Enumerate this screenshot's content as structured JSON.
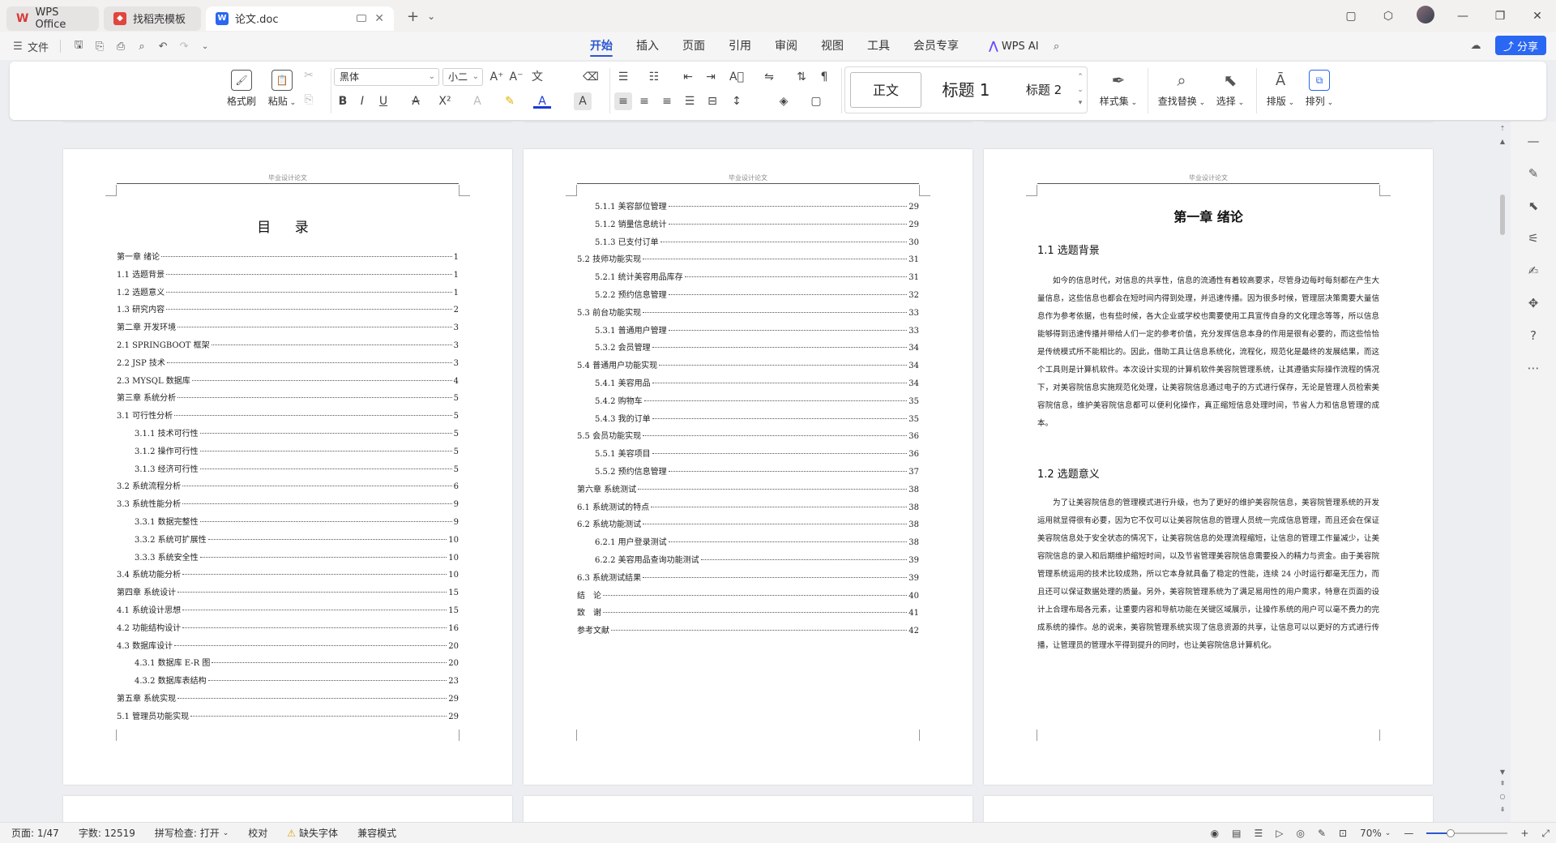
{
  "titlebar": {
    "tabs": [
      {
        "label": "WPS Office",
        "icon": "wps-logo-icon",
        "color": "#d63a3a"
      },
      {
        "label": "找稻壳模板",
        "icon": "docer-icon",
        "color": "#e0463d"
      },
      {
        "label": "论文.doc",
        "icon": "word-doc-icon",
        "color": "#2a67f2"
      }
    ],
    "new_tab": "+",
    "new_tab_menu": "⌄"
  },
  "menubar": {
    "file_label": "文件",
    "tabs": [
      "开始",
      "插入",
      "页面",
      "引用",
      "审阅",
      "视图",
      "工具",
      "会员专享"
    ],
    "active_tab": "开始",
    "ai_label": "WPS AI",
    "share_label": "分享"
  },
  "ribbon": {
    "format_painter": "格式刷",
    "paste": "粘贴",
    "font_name": "黑体",
    "font_size": "小二",
    "styles": {
      "normal": "正文",
      "h1": "标题 1",
      "h2": "标题 2"
    },
    "style_set": "样式集",
    "find_replace": "查找替换",
    "select": "选择",
    "layout": "排版",
    "arrange": "排列"
  },
  "pages": {
    "header_text": "毕业设计论文",
    "toc_title": "目 录",
    "toc_page1": [
      {
        "t": "第一章 绪论",
        "p": "1",
        "lvl": 1
      },
      {
        "t": "1.1 选题背景",
        "p": "1",
        "lvl": 1
      },
      {
        "t": "1.2 选题意义",
        "p": "1",
        "lvl": 1
      },
      {
        "t": "1.3 研究内容",
        "p": "2",
        "lvl": 1
      },
      {
        "t": "第二章 开发环境",
        "p": "3",
        "lvl": 1
      },
      {
        "t": "2.1 SPRINGBOOT 框架",
        "p": "3",
        "lvl": 1
      },
      {
        "t": "2.2 JSP 技术",
        "p": "3",
        "lvl": 1
      },
      {
        "t": "2.3 MYSQL 数据库",
        "p": "4",
        "lvl": 1
      },
      {
        "t": "第三章 系统分析",
        "p": "5",
        "lvl": 1
      },
      {
        "t": "3.1 可行性分析",
        "p": "5",
        "lvl": 1
      },
      {
        "t": "3.1.1 技术可行性",
        "p": "5",
        "lvl": 2
      },
      {
        "t": "3.1.2 操作可行性",
        "p": "5",
        "lvl": 2
      },
      {
        "t": "3.1.3 经济可行性",
        "p": "5",
        "lvl": 2
      },
      {
        "t": "3.2 系统流程分析",
        "p": "6",
        "lvl": 1
      },
      {
        "t": "3.3 系统性能分析",
        "p": "9",
        "lvl": 1
      },
      {
        "t": "3.3.1 数据完整性",
        "p": "9",
        "lvl": 2
      },
      {
        "t": "3.3.2 系统可扩展性",
        "p": "10",
        "lvl": 2
      },
      {
        "t": "3.3.3 系统安全性",
        "p": "10",
        "lvl": 2
      },
      {
        "t": "3.4 系统功能分析",
        "p": "10",
        "lvl": 1
      },
      {
        "t": "第四章 系统设计",
        "p": "15",
        "lvl": 1
      },
      {
        "t": "4.1 系统设计思想",
        "p": "15",
        "lvl": 1
      },
      {
        "t": "4.2 功能结构设计",
        "p": "16",
        "lvl": 1
      },
      {
        "t": "4.3 数据库设计",
        "p": "20",
        "lvl": 1
      },
      {
        "t": "4.3.1 数据库 E-R 图",
        "p": "20",
        "lvl": 2
      },
      {
        "t": "4.3.2 数据库表结构",
        "p": "23",
        "lvl": 2
      },
      {
        "t": "第五章 系统实现",
        "p": "29",
        "lvl": 1
      },
      {
        "t": "5.1 管理员功能实现",
        "p": "29",
        "lvl": 1
      }
    ],
    "toc_page2": [
      {
        "t": "5.1.1 美容部位管理",
        "p": "29",
        "lvl": 2
      },
      {
        "t": "5.1.2 销量信息统计",
        "p": "29",
        "lvl": 2
      },
      {
        "t": "5.1.3 已支付订单",
        "p": "30",
        "lvl": 2
      },
      {
        "t": "5.2 技师功能实现",
        "p": "31",
        "lvl": 1
      },
      {
        "t": "5.2.1 统计美容用品库存",
        "p": "31",
        "lvl": 2
      },
      {
        "t": "5.2.2 预约信息管理",
        "p": "32",
        "lvl": 2
      },
      {
        "t": "5.3 前台功能实现",
        "p": "33",
        "lvl": 1
      },
      {
        "t": "5.3.1 普通用户管理",
        "p": "33",
        "lvl": 2
      },
      {
        "t": "5.3.2 会员管理",
        "p": "34",
        "lvl": 2
      },
      {
        "t": "5.4 普通用户功能实现",
        "p": "34",
        "lvl": 1
      },
      {
        "t": "5.4.1 美容用品",
        "p": "34",
        "lvl": 2
      },
      {
        "t": "5.4.2 购物车",
        "p": "35",
        "lvl": 2
      },
      {
        "t": "5.4.3 我的订单",
        "p": "35",
        "lvl": 2
      },
      {
        "t": "5.5 会员功能实现",
        "p": "36",
        "lvl": 1
      },
      {
        "t": "5.5.1 美容项目",
        "p": "36",
        "lvl": 2
      },
      {
        "t": "5.5.2 预约信息管理",
        "p": "37",
        "lvl": 2
      },
      {
        "t": "第六章 系统测试",
        "p": "38",
        "lvl": 1
      },
      {
        "t": "6.1 系统测试的特点",
        "p": "38",
        "lvl": 1
      },
      {
        "t": "6.2 系统功能测试",
        "p": "38",
        "lvl": 1
      },
      {
        "t": "6.2.1 用户登录测试",
        "p": "38",
        "lvl": 2
      },
      {
        "t": "6.2.2 美容用品查询功能测试",
        "p": "39",
        "lvl": 2
      },
      {
        "t": "6.3 系统测试结果",
        "p": "39",
        "lvl": 1
      },
      {
        "t": "结　论",
        "p": "40",
        "lvl": 1
      },
      {
        "t": "致　谢",
        "p": "41",
        "lvl": 1
      },
      {
        "t": "参考文献",
        "p": "42",
        "lvl": 1
      }
    ],
    "chapter_title": "第一章 绪论",
    "sec1_title": "1.1 选题背景",
    "sec1_para": "如今的信息时代，对信息的共享性，信息的流通性有着较高要求，尽管身边每时每刻都在产生大量信息，这些信息也都会在短时间内得到处理，并迅速传播。因为很多时候，管理层决策需要大量信息作为参考依据，也有些时候，各大企业或学校也需要使用工具宣传自身的文化理念等等，所以信息能够得到迅速传播并带给人们一定的参考价值，充分发挥信息本身的作用是很有必要的，而这些恰恰是传统模式所不能相比的。因此，借助工具让信息系统化，流程化，规范化是最终的发展结果，而这个工具则是计算机软件。本次设计实现的计算机软件美容院管理系统，让其遵循实际操作流程的情况下，对美容院信息实施规范化处理，让美容院信息通过电子的方式进行保存，无论是管理人员检索美容院信息，维护美容院信息都可以便利化操作，真正缩短信息处理时间，节省人力和信息管理的成本。",
    "sec2_title": "1.2 选题意义",
    "sec2_para": "为了让美容院信息的管理模式进行升级，也为了更好的维护美容院信息，美容院管理系统的开发运用就显得很有必要，因为它不仅可以让美容院信息的管理人员统一完成信息管理，而且还会在保证美容院信息处于安全状态的情况下，让美容院信息的处理流程缩短，让信息的管理工作量减少，让美容院信息的录入和后期维护缩短时间，以及节省管理美容院信息需要投入的精力与资金。由于美容院管理系统运用的技术比较成熟，所以它本身就具备了稳定的性能，连续 24 小时运行都毫无压力，而且还可以保证数据处理的质量。另外，美容院管理系统为了满足易用性的用户需求，特意在页面的设计上合理布局各元素，让重要内容和导航功能在关键区域展示，让操作系统的用户可以毫不费力的完成系统的操作。总的说来，美容院管理系统实现了信息资源的共享，让信息可以以更好的方式进行传播，让管理员的管理水平得到提升的同时，也让美容院信息计算机化。"
  },
  "statusbar": {
    "page": "页面: 1/47",
    "words": "字数: 12519",
    "spellcheck": "拼写检查: 打开",
    "proof": "校对",
    "missing_font": "缺失字体",
    "compat": "兼容模式",
    "zoom": "70%",
    "zoom_fraction": 0.3
  }
}
